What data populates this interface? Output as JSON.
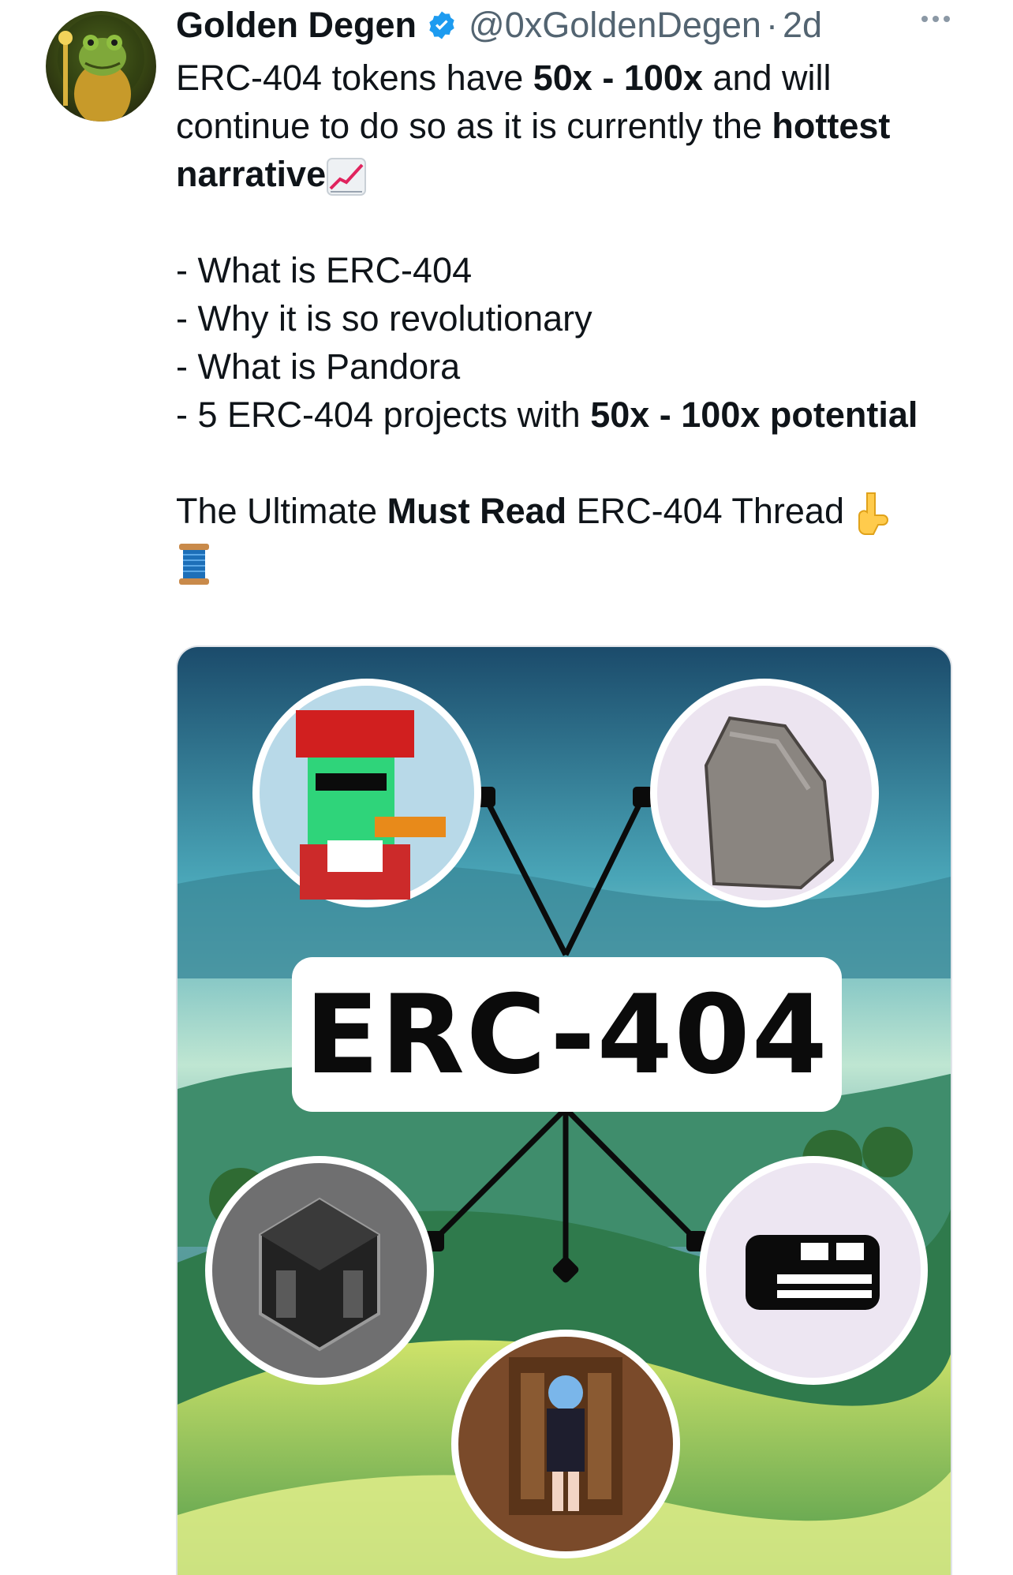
{
  "tweet": {
    "author_name": "Golden Degen",
    "handle": "@0xGoldenDegen",
    "separator": "·",
    "time": "2d",
    "line1_pre": "ERC-404 tokens have ",
    "line1_bold": "50x - 100x",
    "line1_post": " and will continue to do so as it is currently the ",
    "line1_bold2": "hottest narrative",
    "list": [
      "- What is ERC-404",
      "- Why it is so revolutionary",
      "- What is Pandora"
    ],
    "list4_pre": "- 5 ERC-404 projects with ",
    "list4_bold": "50x - 100x potential",
    "closing_pre": "The Ultimate ",
    "closing_bold": "Must Read",
    "closing_post": " ERC-404 Thread"
  },
  "media": {
    "center_label": "ERC-404"
  },
  "icons": {
    "verified": "verified-badge-icon",
    "more": "more-icon",
    "chart": "chart-increasing-emoji",
    "pointing_down": "backhand-index-pointing-down-emoji",
    "thread": "spool-of-thread-emoji"
  },
  "colors": {
    "verified": "#1d9bf0",
    "text": "#0f1419",
    "secondary": "#536471"
  }
}
